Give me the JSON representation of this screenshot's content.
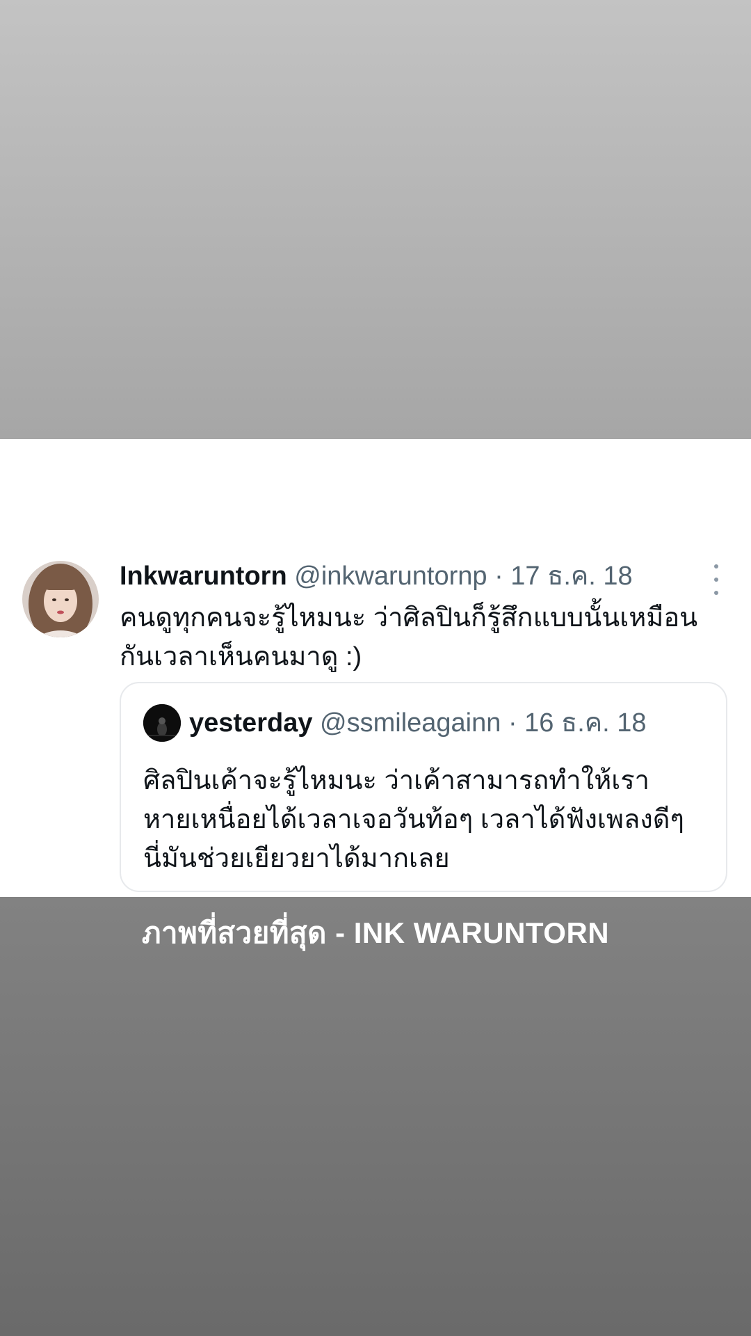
{
  "tweet": {
    "display_name": "Inkwaruntorn",
    "handle": "@inkwaruntornp",
    "separator": " · ",
    "date": "17 ธ.ค. 18",
    "text_lines": [
      "คนดูทุกคนจะรู้ไหมนะ ว่าศิลปินก็รู้สึกแบบนั้นเหมือน",
      "กันเวลาเห็นคนมาดู :)"
    ],
    "more_icon": "more-vertical-icon"
  },
  "quote": {
    "display_name": "yesterday",
    "handle": "@ssmileagainn",
    "separator": " · ",
    "date": "16 ธ.ค. 18",
    "text_lines": [
      "ศิลปินเค้าจะรู้ไหมนะ ว่าเค้าสามารถทำให้เรา",
      "หายเหนื่อยได้เวลาเจอวันท้อๆ เวลาได้ฟังเพลงดีๆ",
      "นี่มันช่วยเยียวยาได้มากเลย"
    ]
  },
  "caption": {
    "text": "ภาพที่สวยที่สุด - INK WARUNTORN"
  },
  "colors": {
    "primary_text": "#0f1419",
    "secondary_text": "#536471",
    "border": "#e7e9ec",
    "card_background": "#ffffff"
  }
}
